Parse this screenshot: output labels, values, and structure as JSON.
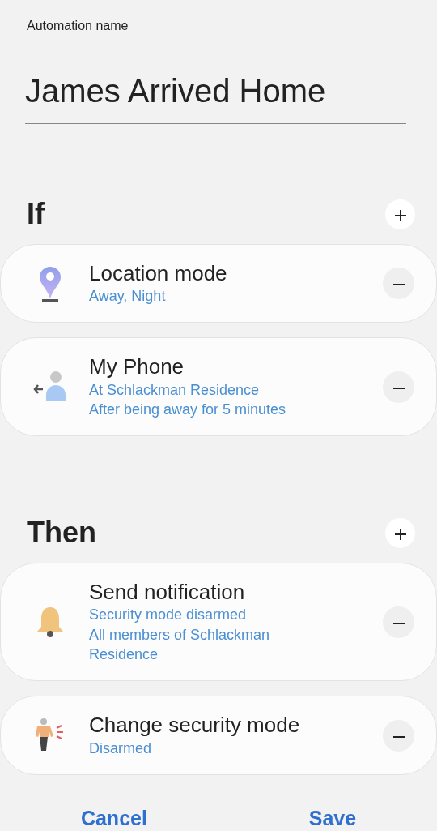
{
  "name_field": {
    "label": "Automation name",
    "value": "James Arrived Home"
  },
  "sections": [
    {
      "title": "If",
      "items": [
        {
          "kind": "location",
          "title": "Location mode",
          "details": [
            "Away, Night"
          ]
        },
        {
          "kind": "presence",
          "title": "My Phone",
          "details": [
            "At Schlackman Residence",
            "After being away for 5 minutes"
          ]
        }
      ]
    },
    {
      "title": "Then",
      "items": [
        {
          "kind": "notification",
          "title": "Send notification",
          "details": [
            "Security mode disarmed",
            "All members of Schlackman Residence"
          ]
        },
        {
          "kind": "security",
          "title": "Change security mode",
          "details": [
            "Disarmed"
          ]
        }
      ]
    }
  ],
  "buttons": [
    "Cancel",
    "Save"
  ]
}
